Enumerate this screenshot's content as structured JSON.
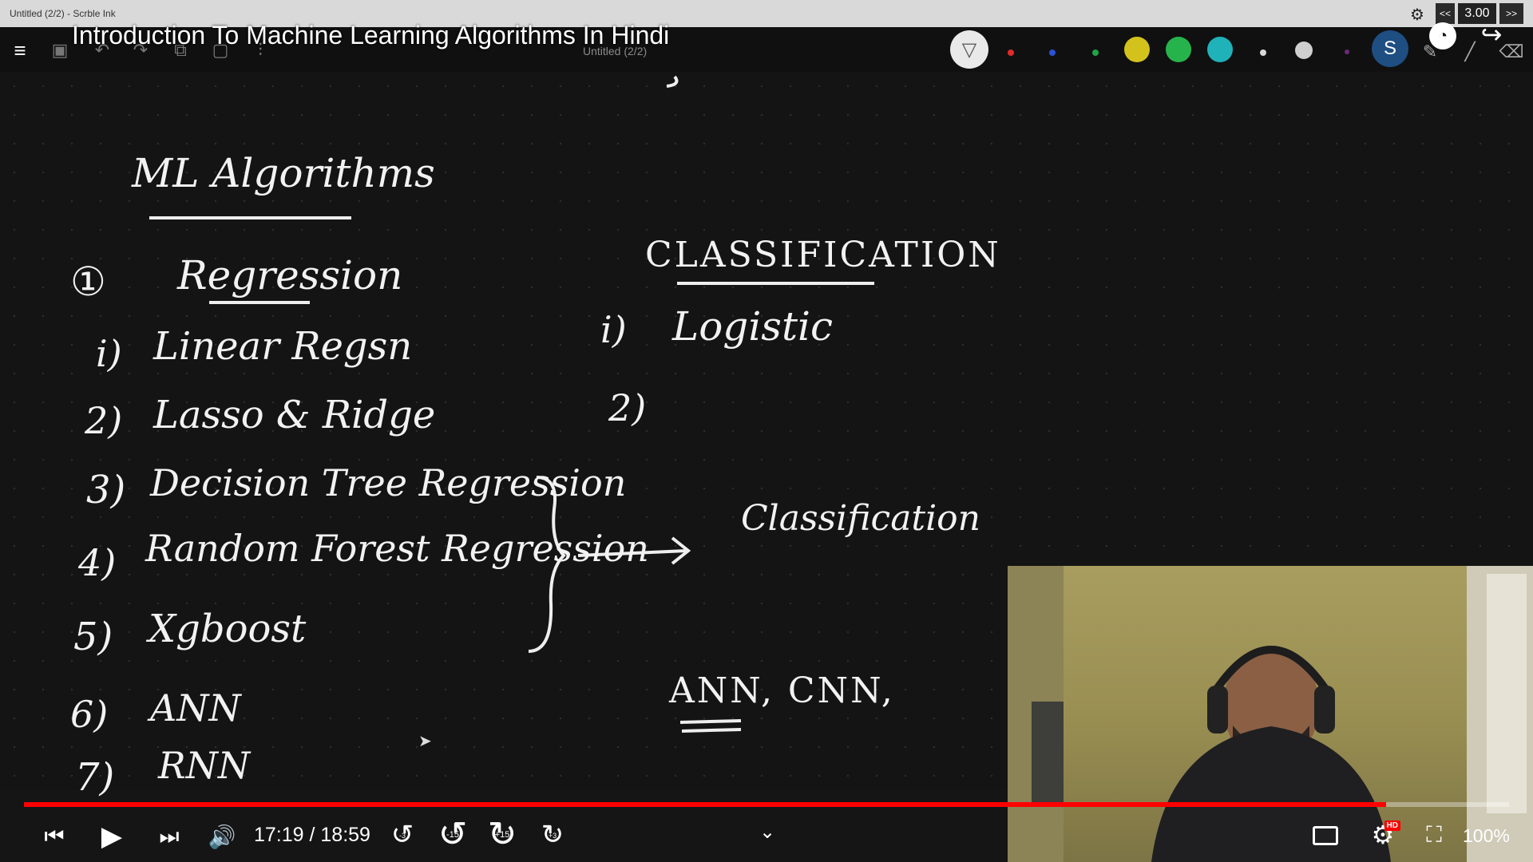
{
  "window": {
    "title": "Untitled (2/2) - Scrble Ink",
    "speed": "3.00",
    "speed_prev": "<<",
    "speed_next": ">>"
  },
  "toolbar": {
    "document_label": "Untitled (2/2)"
  },
  "video": {
    "title": "Introduction To Machine Learning Algorithms In Hindi"
  },
  "palette": {
    "colors": [
      "#e22a2a",
      "#2b52d6",
      "#1fa447",
      "#d4c21c",
      "#27b34c",
      "#1fb2b8",
      "#d9d9d9",
      "#cfcfcf",
      "#6b2a7a"
    ]
  },
  "board": {
    "heading": "ML Algorithms",
    "section1_number": "①",
    "section1_title": "Regression",
    "items": [
      {
        "num": "i)",
        "text": "Linear Regsn"
      },
      {
        "num": "2)",
        "text": "Lasso & Ridge"
      },
      {
        "num": "3)",
        "text": "Decision Tree Regression"
      },
      {
        "num": "4)",
        "text": "Random Forest Regression"
      },
      {
        "num": "5)",
        "text": "Xgboost"
      },
      {
        "num": "6)",
        "text": "ANN"
      },
      {
        "num": "7)",
        "text": "RNN"
      }
    ],
    "classification_heading": "CLASSIFICATION",
    "class_items": [
      {
        "num": "i)",
        "text": "Logistic"
      },
      {
        "num": "2)",
        "text": ""
      }
    ],
    "arrow_target": "Classification",
    "nn_text": "ANN, CNN,"
  },
  "player": {
    "time": "17:19 / 18:59",
    "progress": 0.917,
    "zoom": "100%",
    "seek_back_small": "-3",
    "seek_back": "-15",
    "seek_fwd": "+15",
    "seek_fwd_small": "+3",
    "hd_badge": "HD"
  }
}
